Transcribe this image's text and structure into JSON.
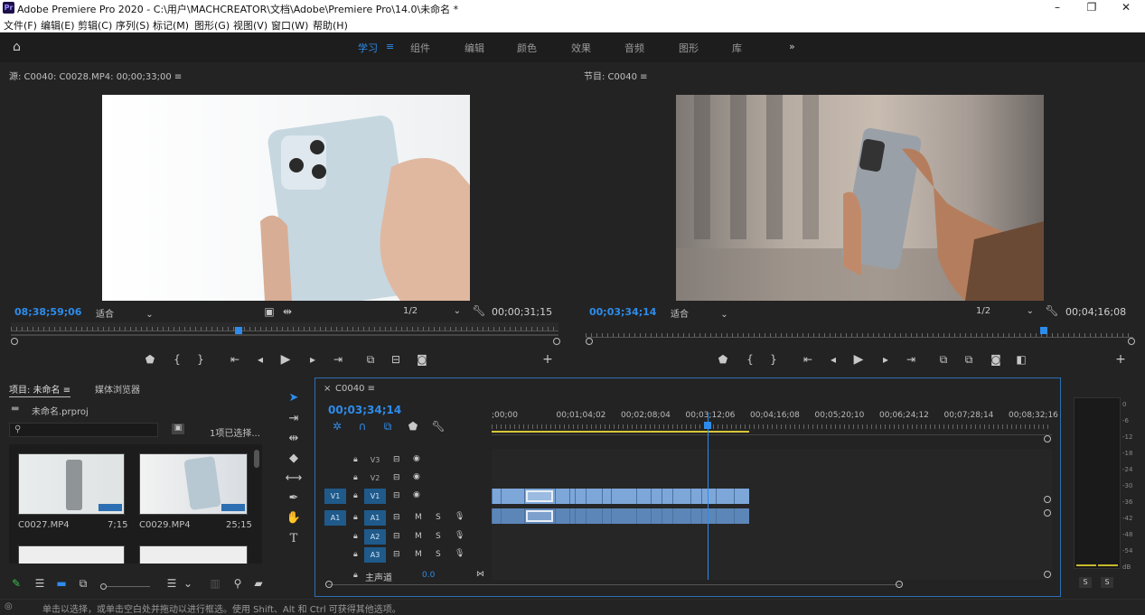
{
  "window": {
    "title": "Adobe Premiere Pro 2020 - C:\\用户\\MACHCREATOR\\文档\\Adobe\\Premiere Pro\\14.0\\未命名 *",
    "app_icon": "Pr"
  },
  "menu": [
    "文件(F)",
    "编辑(E)",
    "剪辑(C)",
    "序列(S)",
    "标记(M)",
    "图形(G)",
    "视图(V)",
    "窗口(W)",
    "帮助(H)"
  ],
  "workspaces": {
    "items": [
      "学习",
      "组件",
      "编辑",
      "颜色",
      "效果",
      "音频",
      "图形",
      "库"
    ],
    "active": "学习",
    "more": "»"
  },
  "source": {
    "header": "源: C0040: C0028.MP4: 00;00;33;00 ≡",
    "timecode": "08;38;59;06",
    "fit": "适合",
    "resolution": "1/2",
    "duration": "00;00;31;15",
    "playhead_fraction": 0.41
  },
  "program": {
    "header": "节目: C0040 ≡",
    "timecode": "00;03;34;14",
    "fit": "适合",
    "resolution": "1/2",
    "duration": "00;04;16;08",
    "playhead_fraction": 0.83
  },
  "project": {
    "tab_project": "项目: 未命名",
    "tab_media": "媒体浏览器",
    "file": "未命名.prproj",
    "selection": "1项已选择...",
    "items": [
      {
        "name": "C0027.MP4",
        "duration": "7;15"
      },
      {
        "name": "C0029.MP4",
        "duration": "25;15"
      }
    ]
  },
  "timeline": {
    "sequence": "C0040",
    "timecode": "00;03;34;14",
    "ruler": [
      ";00;00",
      "00;01;04;02",
      "00;02;08;04",
      "00;03;12;06",
      "00;04;16;08",
      "00;05;20;10",
      "00;06;24;12",
      "00;07;28;14",
      "00;08;32;16"
    ],
    "video_tracks": [
      "V3",
      "V2",
      "V1"
    ],
    "audio_tracks": [
      "A1",
      "A2",
      "A3"
    ],
    "source_patch_v": "V1",
    "source_patch_a": "A1",
    "master": "主声道",
    "master_value": "0.0",
    "m_label": "M",
    "s_label": "S"
  },
  "meter": {
    "labels": [
      "0",
      "-6",
      "-12",
      "-18",
      "-24",
      "-30",
      "-36",
      "-42",
      "-48",
      "-54",
      "dB"
    ],
    "solo": [
      "S",
      "S"
    ]
  },
  "status": "单击以选择，或单击空白处并拖动以进行框选。使用 Shift、Alt 和 Ctrl 可获得其他选项。",
  "colors": {
    "accent": "#2d8ceb",
    "video_clip": "#7da7d9",
    "audio_clip": "#5d86b8"
  }
}
